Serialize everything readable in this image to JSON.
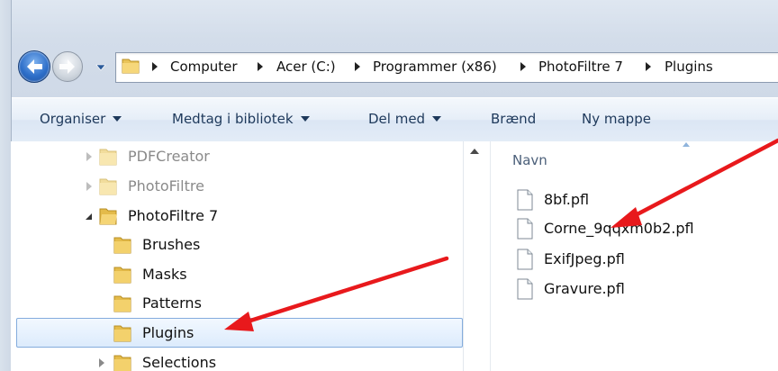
{
  "address": {
    "crumbs": [
      "Computer",
      "Acer (C:)",
      "Programmer (x86)",
      "PhotoFiltre 7",
      "Plugins"
    ]
  },
  "toolbar": {
    "organise": "Organiser",
    "include_library": "Medtag i bibliotek",
    "share_with": "Del med",
    "burn": "Brænd",
    "new_folder": "Ny mappe"
  },
  "tree": {
    "items": [
      {
        "label": "PDFCreator",
        "state": "dimmed"
      },
      {
        "label": "PhotoFiltre",
        "state": "dimmed"
      },
      {
        "label": "PhotoFiltre 7",
        "state": "expanded"
      },
      {
        "label": "Brushes"
      },
      {
        "label": "Masks"
      },
      {
        "label": "Patterns"
      },
      {
        "label": "Plugins",
        "state": "selected"
      },
      {
        "label": "Selections"
      }
    ]
  },
  "files": {
    "column_name": "Navn",
    "items": [
      {
        "name": "8bf.pfl"
      },
      {
        "name": "Corne_9qqxm0b2.pfl"
      },
      {
        "name": "ExifJpeg.pfl"
      },
      {
        "name": "Gravure.pfl"
      }
    ]
  },
  "annotations": {
    "arrow_color": "#e8191c"
  }
}
